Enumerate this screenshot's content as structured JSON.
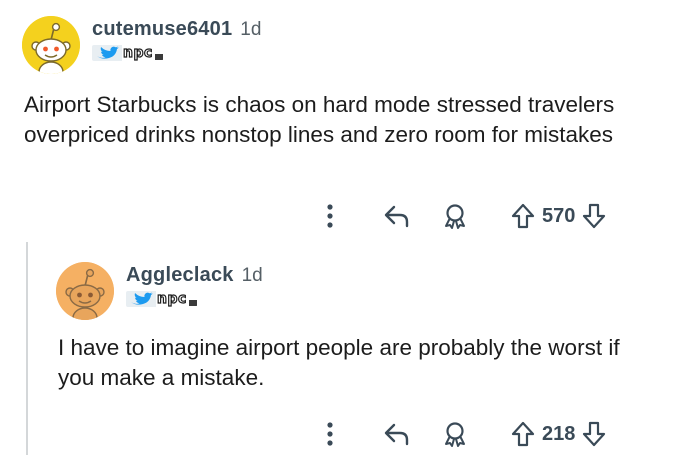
{
  "comments": [
    {
      "username": "cutemuse6401",
      "age": "1d",
      "flair_text": "npc",
      "body": "Airport Starbucks is chaos on hard mode stressed travelers overpriced drinks nonstop lines and zero room for mistakes",
      "score": "570",
      "avatar_color": "#F4D11E"
    },
    {
      "username": "Aggleclack",
      "age": "1d",
      "flair_text": "npc",
      "body": "I have to imagine airport people are probably the worst if you make a mistake.",
      "score": "218",
      "avatar_color": "#F5B063"
    }
  ],
  "icons": {
    "more": "more-vertical-icon",
    "reply": "reply-arrow-icon",
    "award": "award-icon",
    "upvote": "upvote-arrow-icon",
    "downvote": "downvote-arrow-icon"
  }
}
